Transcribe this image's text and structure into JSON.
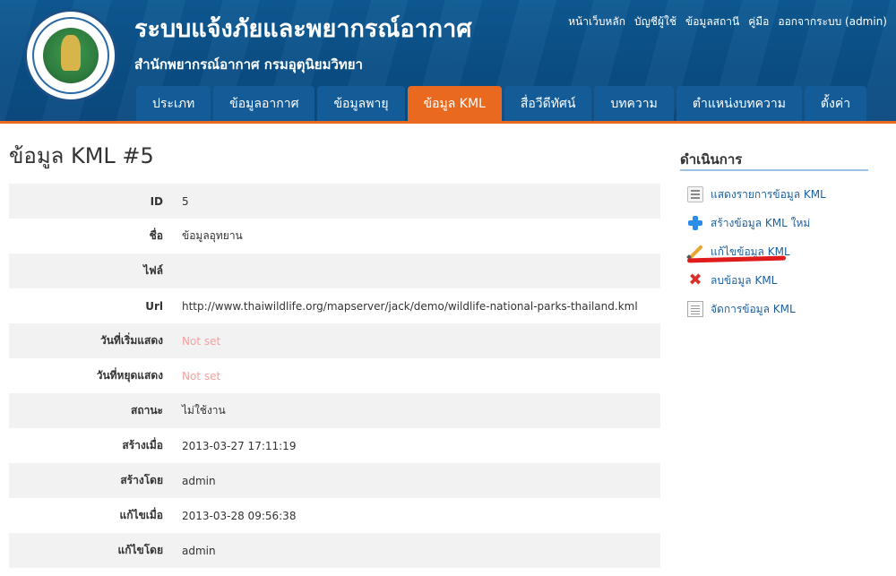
{
  "header": {
    "title": "ระบบแจ้งภัยและพยากรณ์อากาศ",
    "subtitle": "สำนักพยากรณ์อากาศ กรมอุตุนิยมวิทยา",
    "top_links": [
      "หน้าเว็บหลัก",
      "บัญชีผู้ใช้",
      "ข้อมูลสถานี",
      "คู่มือ",
      "ออกจากระบบ (admin)"
    ]
  },
  "nav": {
    "items": [
      "ประเภท",
      "ข้อมูลอากาศ",
      "ข้อมูลพายุ",
      "ข้อมูล KML",
      "สื่อวีดีทัศน์",
      "บทความ",
      "ตำแหน่งบทความ",
      "ตั้งค่า"
    ],
    "active": "ข้อมูล KML"
  },
  "page": {
    "title": "ข้อมูล KML #5"
  },
  "detail": {
    "rows": [
      {
        "label": "ID",
        "value": "5"
      },
      {
        "label": "ชื่อ",
        "value": "ข้อมูลอุทยาน"
      },
      {
        "label": "ไฟล์",
        "value": ""
      },
      {
        "label": "Url",
        "value": "http://www.thaiwildlife.org/mapserver/jack/demo/wildlife-national-parks-thailand.kml"
      },
      {
        "label": "วันที่เริ่มแสดง",
        "value": "Not set"
      },
      {
        "label": "วันที่หยุดแสดง",
        "value": "Not set"
      },
      {
        "label": "สถานะ",
        "value": "ไม่ใช้งาน"
      },
      {
        "label": "สร้างเมื่อ",
        "value": "2013-03-27 17:11:19"
      },
      {
        "label": "สร้างโดย",
        "value": "admin"
      },
      {
        "label": "แก้ไขเมื่อ",
        "value": "2013-03-28 09:56:38"
      },
      {
        "label": "แก้ไขโดย",
        "value": "admin"
      }
    ]
  },
  "sidebar": {
    "title": "ดำเนินการ",
    "operations": [
      {
        "label": "แสดงรายการข้อมูล KML",
        "icon": "list-icon"
      },
      {
        "label": "สร้างข้อมูล KML ใหม่",
        "icon": "plus-icon"
      },
      {
        "label": "แก้ไขข้อมูล KML",
        "icon": "pencil-icon"
      },
      {
        "label": "ลบข้อมูล KML",
        "icon": "delete-icon"
      },
      {
        "label": "จัดการข้อมูล KML",
        "icon": "document-icon"
      }
    ]
  },
  "colors": {
    "header_bg": "#0a4f86",
    "accent": "#e96a1f",
    "link": "#1d5f9e",
    "not_set": "#f5a0a0",
    "highlight": "#e01b1b"
  }
}
